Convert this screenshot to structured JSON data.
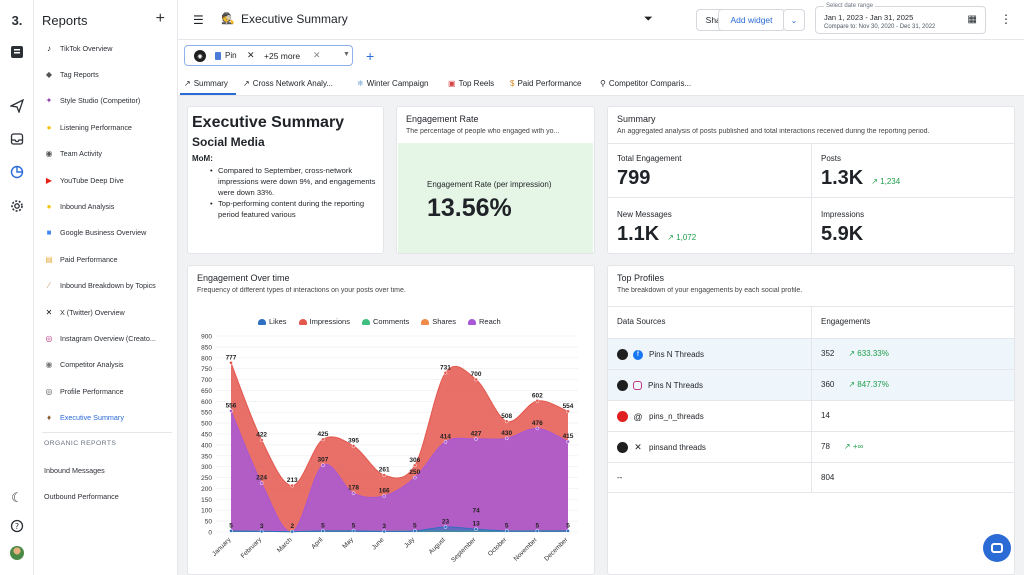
{
  "sidebar": {
    "title": "Reports",
    "items": [
      {
        "label": "TikTok Overview",
        "icon": "tiktok-icon"
      },
      {
        "label": "Tag Reports",
        "icon": "tag-icon"
      },
      {
        "label": "Style Studio (Competitor)",
        "icon": "style-studio-icon"
      },
      {
        "label": "Listening Performance",
        "icon": "lightbulb-icon"
      },
      {
        "label": "Team Activity",
        "icon": "team-icon"
      },
      {
        "label": "YouTube Deep Dive",
        "icon": "youtube-icon"
      },
      {
        "label": "Inbound Analysis",
        "icon": "emoji-icon"
      },
      {
        "label": "Google Business Overview",
        "icon": "google-business-icon"
      },
      {
        "label": "Paid Performance",
        "icon": "report-icon"
      },
      {
        "label": "Inbound Breakdown by Topics",
        "icon": "broom-icon"
      },
      {
        "label": "X (Twitter) Overview",
        "icon": "x-icon"
      },
      {
        "label": "Instagram Overview (Creato...",
        "icon": "instagram-icon"
      },
      {
        "label": "Competitor Analysis",
        "icon": "eye-icon"
      },
      {
        "label": "Profile Performance",
        "icon": "profile-icon"
      },
      {
        "label": "Executive Summary",
        "icon": "detective-icon",
        "active": true
      }
    ],
    "section": "ORGANIC REPORTS",
    "organic_items": [
      {
        "label": "Inbound Messages"
      },
      {
        "label": "Outbound Performance"
      }
    ]
  },
  "header": {
    "title": "Executive Summary",
    "share_label": "Share",
    "add_widget_label": "Add widget",
    "date_range": {
      "label": "Select date range",
      "main": "Jan 1, 2023 - Jan 31, 2025",
      "compare": "Compare to: Nov 30, 2020 - Dec 31, 2022"
    }
  },
  "filter": {
    "profile_chip": "Pin",
    "more": "+25 more"
  },
  "tabs": [
    {
      "label": "Summary",
      "icon": "↗"
    },
    {
      "label": "Cross Network Analy...",
      "icon": "↗"
    },
    {
      "label": "Winter Campaign",
      "icon": "❄"
    },
    {
      "label": "Top Reels",
      "icon": "▣"
    },
    {
      "label": "Paid Performance",
      "icon": "$"
    },
    {
      "label": "Competitor Comparis...",
      "icon": "⚲"
    }
  ],
  "exec_card": {
    "title": "Executive Summary",
    "subtitle": "Social Media",
    "mom": "MoM:",
    "bullets": [
      "Compared to September, cross-network impressions were down 9%, and engagements were down 33%.",
      "Top-performing content during the reporting period featured various"
    ]
  },
  "engagement_rate": {
    "title": "Engagement Rate",
    "subtitle": "The percentage of people who engaged with yo...",
    "label": "Engagement Rate (per impression)",
    "value": "13.56%"
  },
  "summary": {
    "title": "Summary",
    "subtitle": "An aggregated analysis of posts published and total interactions received during the reporting period.",
    "metrics": [
      {
        "label": "Total Engagement",
        "value": "799",
        "change": ""
      },
      {
        "label": "Posts",
        "value": "1.3K",
        "change": "↗ 1,234"
      },
      {
        "label": "New Messages",
        "value": "1.1K",
        "change": "↗ 1,072"
      },
      {
        "label": "Impressions",
        "value": "5.9K",
        "change": ""
      }
    ]
  },
  "engagement_over_time": {
    "title": "Engagement Over time",
    "subtitle": "Frequency of different types of interactions on your posts over time."
  },
  "chart_data": {
    "type": "area",
    "categories": [
      "January",
      "February",
      "March",
      "April",
      "May",
      "June",
      "July",
      "August",
      "September",
      "October",
      "November",
      "December"
    ],
    "ylim": [
      0,
      900
    ],
    "yticks": [
      0,
      50,
      100,
      150,
      200,
      250,
      300,
      350,
      400,
      450,
      500,
      550,
      600,
      650,
      700,
      750,
      800,
      850,
      900
    ],
    "legend": "top",
    "series": [
      {
        "name": "Likes",
        "color": "#2f6fc2",
        "values": [
          5,
          3,
          2,
          5,
          5,
          3,
          5,
          23,
          13,
          5,
          5,
          5
        ]
      },
      {
        "name": "Impressions",
        "color": "#e4574e",
        "values": [
          777,
          422,
          213,
          425,
          395,
          261,
          306,
          731,
          700,
          508,
          602,
          554
        ]
      },
      {
        "name": "Comments",
        "color": "#3fbf7f",
        "values": [
          5,
          3,
          2,
          5,
          5,
          3,
          5,
          5,
          5,
          5,
          5,
          5
        ]
      },
      {
        "name": "Shares",
        "color": "#f08a4b",
        "values": [
          5,
          3,
          2,
          5,
          5,
          3,
          5,
          5,
          5,
          5,
          5,
          5
        ]
      },
      {
        "name": "Reach",
        "color": "#a858d6",
        "values": [
          556,
          224,
          2,
          307,
          178,
          166,
          250,
          414,
          427,
          430,
          476,
          415
        ]
      }
    ],
    "point_labels": [
      {
        "series": "Impressions",
        "values": [
          "777",
          "422",
          "213",
          "425",
          "395",
          "261",
          "306",
          "731",
          "700",
          "508",
          "602",
          "554"
        ]
      },
      {
        "series": "Reach",
        "values": [
          "556",
          "224",
          "",
          "307",
          "178",
          "166",
          "250",
          "414",
          "427",
          "430",
          "476",
          "415"
        ]
      },
      {
        "series": "Likes",
        "values": [
          "5",
          "3",
          "2",
          "5",
          "5",
          "3",
          "5",
          "23",
          "13",
          "5",
          "5",
          "5"
        ]
      },
      {
        "series": "Secondary",
        "values": [
          "",
          "",
          "",
          "",
          "",
          "",
          "",
          "",
          "74",
          "",
          "",
          ""
        ]
      }
    ]
  },
  "top_profiles": {
    "title": "Top Profiles",
    "subtitle": "The breakdown of your engagements by each social profile.",
    "columns": [
      "Data Sources",
      "Engagements"
    ],
    "rows": [
      {
        "name": "Pins N Threads",
        "network": "facebook",
        "value": "352",
        "change": "↗ 633.33%"
      },
      {
        "name": "Pins N Threads",
        "network": "instagram",
        "value": "360",
        "change": "↗ 847.37%"
      },
      {
        "name": "pins_n_threads",
        "network": "threads",
        "value": "14",
        "change": ""
      },
      {
        "name": "pinsand threads",
        "network": "x",
        "value": "78",
        "change": "↗ +∞"
      },
      {
        "name": "--",
        "network": "",
        "value": "804",
        "change": ""
      }
    ]
  }
}
